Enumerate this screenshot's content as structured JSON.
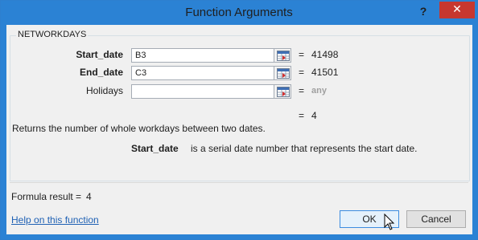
{
  "window": {
    "title": "Function Arguments",
    "help_glyph": "?",
    "close_glyph": "✕"
  },
  "function": {
    "name": "NETWORKDAYS",
    "args": [
      {
        "label": "Start_date",
        "value": "B3",
        "result": "41498",
        "bold": true
      },
      {
        "label": "End_date",
        "value": "C3",
        "result": "41501",
        "bold": true
      },
      {
        "label": "Holidays",
        "value": "",
        "result": "any",
        "bold": false
      }
    ],
    "equals": "=",
    "overall_result": "4",
    "description": "Returns the number of whole workdays between two dates.",
    "arg_help_name": "Start_date",
    "arg_help_text": "is a serial date number that represents the start date."
  },
  "footer": {
    "formula_result_label": "Formula result =",
    "formula_result_value": "4",
    "help_link": "Help on this function",
    "ok_label": "OK",
    "cancel_label": "Cancel"
  },
  "icons": {
    "reference": "collapse-dialog-icon",
    "cursor": "mouse-pointer-icon"
  },
  "colors": {
    "titlebar": "#2b82d4",
    "close": "#c7372f",
    "link": "#1e60b4",
    "ok_border": "#3c8ce0"
  }
}
